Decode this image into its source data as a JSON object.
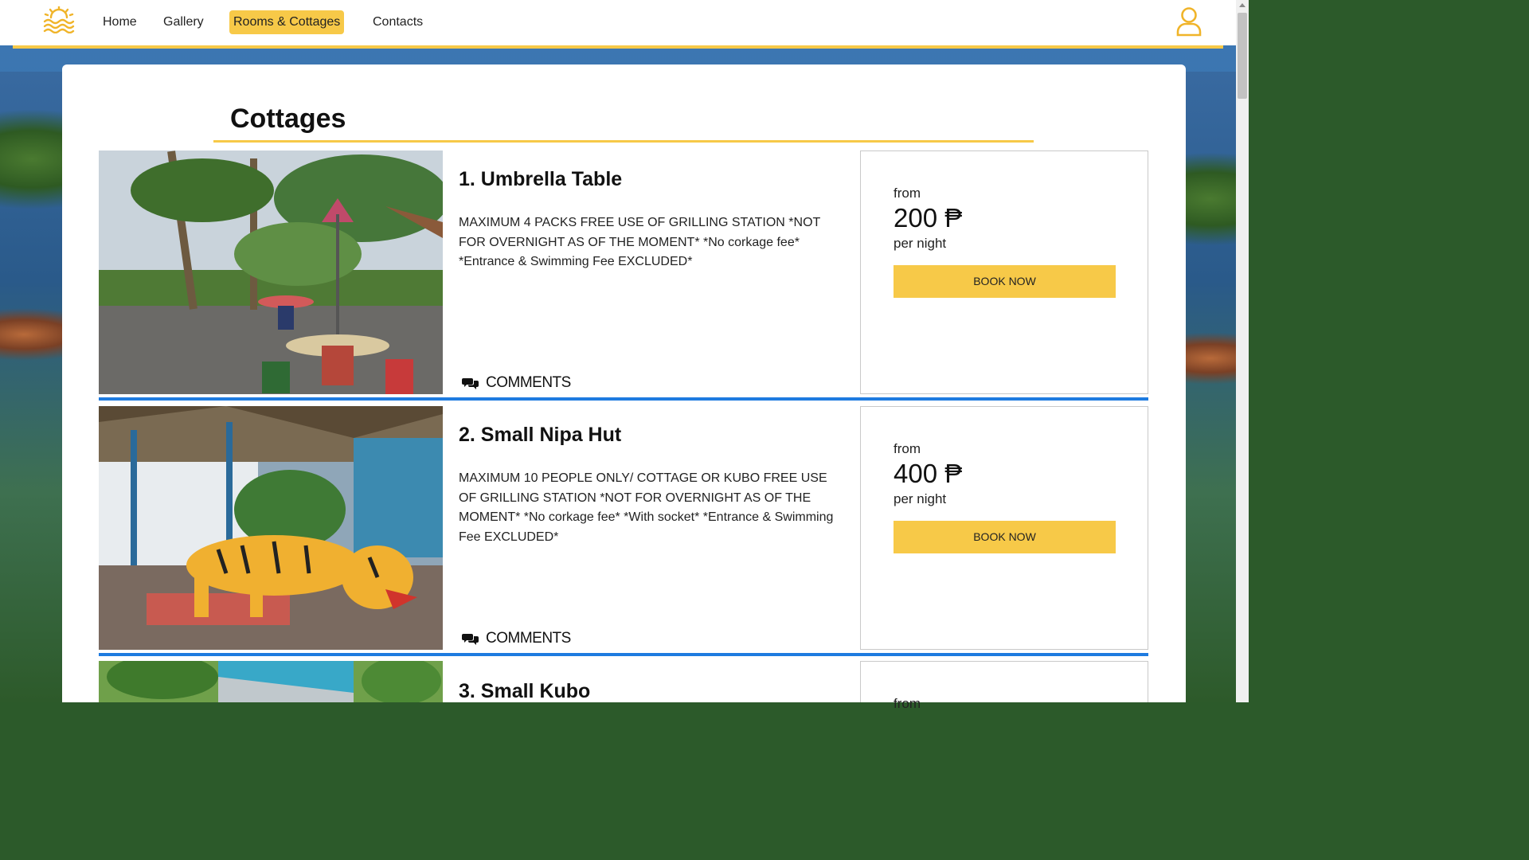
{
  "nav": {
    "items": [
      {
        "label": "Home"
      },
      {
        "label": "Gallery"
      },
      {
        "label": "Rooms & Cottages"
      },
      {
        "label": "Contacts"
      }
    ]
  },
  "colors": {
    "accent": "#f7c948",
    "divider": "#1e7be0"
  },
  "page": {
    "title": "Cottages"
  },
  "cottages": [
    {
      "name": "1. Umbrella Table",
      "description": "MAXIMUM 4 PACKS FREE USE OF GRILLING STATION *NOT FOR OVERNIGHT AS OF THE MOMENT* *No corkage fee* *Entrance & Swimming Fee EXCLUDED*",
      "from_label": "from",
      "price": "200 ₱",
      "per_label": "per night",
      "book_label": "BOOK NOW",
      "comments_label": "COMMENTS"
    },
    {
      "name": "2. Small Nipa Hut",
      "description": "MAXIMUM 10 PEOPLE ONLY/ COTTAGE OR KUBO FREE USE OF GRILLING STATION *NOT FOR OVERNIGHT AS OF THE MOMENT* *No corkage fee* *With socket* *Entrance & Swimming Fee EXCLUDED*",
      "from_label": "from",
      "price": "400 ₱",
      "per_label": "per night",
      "book_label": "BOOK NOW",
      "comments_label": "COMMENTS"
    },
    {
      "name": "3. Small Kubo",
      "from_label": "from"
    }
  ]
}
